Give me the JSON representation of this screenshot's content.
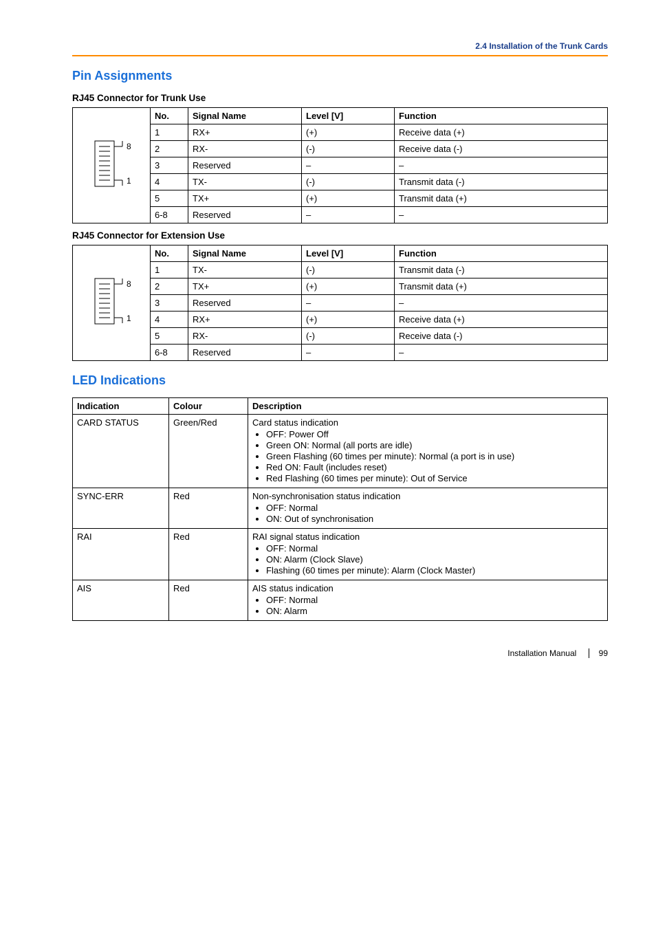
{
  "header": {
    "title": "2.4 Installation of the Trunk Cards"
  },
  "sections": {
    "pin": {
      "title": "Pin Assignments"
    },
    "led": {
      "title": "LED Indications"
    }
  },
  "pin_tables": {
    "trunk": {
      "heading": "RJ45 Connector for Trunk Use",
      "columns": {
        "no": "No.",
        "signal": "Signal Name",
        "level": "Level [V]",
        "function": "Function"
      },
      "connector_labels": {
        "top": "8",
        "bottom": "1"
      },
      "rows": [
        {
          "no": "1",
          "signal": "RX+",
          "level": "(+)",
          "function": "Receive data (+)"
        },
        {
          "no": "2",
          "signal": "RX-",
          "level": "(-)",
          "function": "Receive data (-)"
        },
        {
          "no": "3",
          "signal": "Reserved",
          "level": "–",
          "function": "–"
        },
        {
          "no": "4",
          "signal": "TX-",
          "level": "(-)",
          "function": "Transmit data (-)"
        },
        {
          "no": "5",
          "signal": "TX+",
          "level": "(+)",
          "function": "Transmit data (+)"
        },
        {
          "no": "6-8",
          "signal": "Reserved",
          "level": "–",
          "function": "–"
        }
      ]
    },
    "ext": {
      "heading": "RJ45 Connector for Extension Use",
      "columns": {
        "no": "No.",
        "signal": "Signal Name",
        "level": "Level [V]",
        "function": "Function"
      },
      "connector_labels": {
        "top": "8",
        "bottom": "1"
      },
      "rows": [
        {
          "no": "1",
          "signal": "TX-",
          "level": "(-)",
          "function": "Transmit data (-)"
        },
        {
          "no": "2",
          "signal": "TX+",
          "level": "(+)",
          "function": "Transmit data (+)"
        },
        {
          "no": "3",
          "signal": "Reserved",
          "level": "–",
          "function": "–"
        },
        {
          "no": "4",
          "signal": "RX+",
          "level": "(+)",
          "function": "Receive data (+)"
        },
        {
          "no": "5",
          "signal": "RX-",
          "level": "(-)",
          "function": "Receive data (-)"
        },
        {
          "no": "6-8",
          "signal": "Reserved",
          "level": "–",
          "function": "–"
        }
      ]
    }
  },
  "led_table": {
    "columns": {
      "indication": "Indication",
      "colour": "Colour",
      "description": "Description"
    },
    "rows": [
      {
        "indication": "CARD STATUS",
        "colour": "Green/Red",
        "lead": "Card status indication",
        "items": [
          "OFF: Power Off",
          "Green ON: Normal (all ports are idle)",
          "Green Flashing (60 times per minute): Normal (a port is in use)",
          "Red ON: Fault (includes reset)",
          "Red Flashing (60 times per minute): Out of Service"
        ]
      },
      {
        "indication": "SYNC-ERR",
        "colour": "Red",
        "lead": "Non-synchronisation status indication",
        "items": [
          "OFF: Normal",
          "ON: Out of synchronisation"
        ]
      },
      {
        "indication": "RAI",
        "colour": "Red",
        "lead": "RAI signal status indication",
        "items": [
          "OFF: Normal",
          "ON: Alarm (Clock Slave)",
          "Flashing (60 times per minute): Alarm (Clock Master)"
        ]
      },
      {
        "indication": "AIS",
        "colour": "Red",
        "lead": "AIS status indication",
        "items": [
          "OFF: Normal",
          "ON: Alarm"
        ]
      }
    ]
  },
  "footer": {
    "label": "Installation Manual",
    "page": "99"
  }
}
